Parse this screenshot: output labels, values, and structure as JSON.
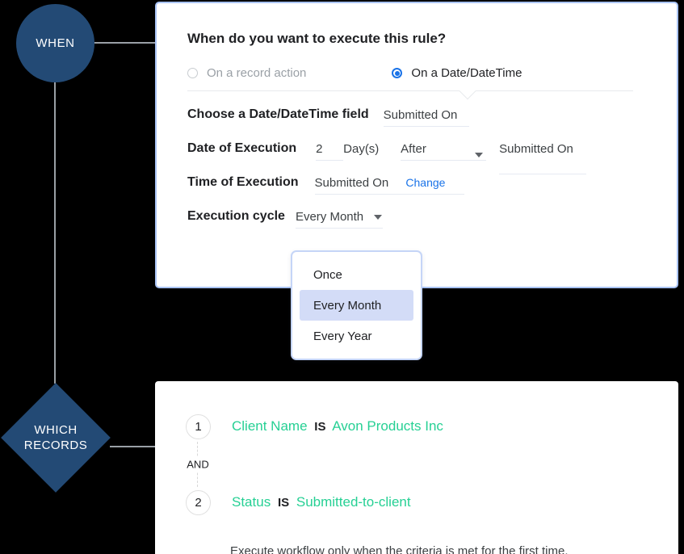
{
  "flow": {
    "when_badge": "WHEN",
    "which_badge_line1": "WHICH",
    "which_badge_line2": "RECORDS",
    "badge_color": "#234a75",
    "connector_color": "#9aa0a6"
  },
  "when_card": {
    "border_color": "#a9c3f5",
    "question": "When do you want to execute this rule?",
    "trigger_options": [
      {
        "label": "On a record action",
        "selected": false
      },
      {
        "label": "On a Date/DateTime",
        "selected": true
      }
    ],
    "accent_color": "#1a73e8",
    "rows": [
      {
        "label": "Choose a Date/DateTime field",
        "value": "Submitted On"
      },
      {
        "label": "Date of Execution",
        "number": "2",
        "unit": "Day(s)",
        "relation": "After",
        "target": "Submitted On"
      },
      {
        "label": "Time of Execution",
        "value": "Submitted On",
        "change_link": "Change"
      },
      {
        "label": "Execution cycle",
        "value": "Every Month"
      }
    ]
  },
  "cycle_dropdown": {
    "open": true,
    "selected": "Every Month",
    "highlight_color": "#d3dcf7",
    "options": [
      "Once",
      "Every Month",
      "Every Year"
    ]
  },
  "which_card": {
    "criteria": [
      {
        "number": "1",
        "field": "Client Name",
        "operator": "IS",
        "value": "Avon Products Inc"
      },
      {
        "number": "2",
        "field": "Status",
        "operator": "IS",
        "value": "Submitted-to-client"
      }
    ],
    "join_operator": "AND",
    "note": "Execute workflow only when the criteria is met for the first time.",
    "value_color": "#26d094"
  }
}
